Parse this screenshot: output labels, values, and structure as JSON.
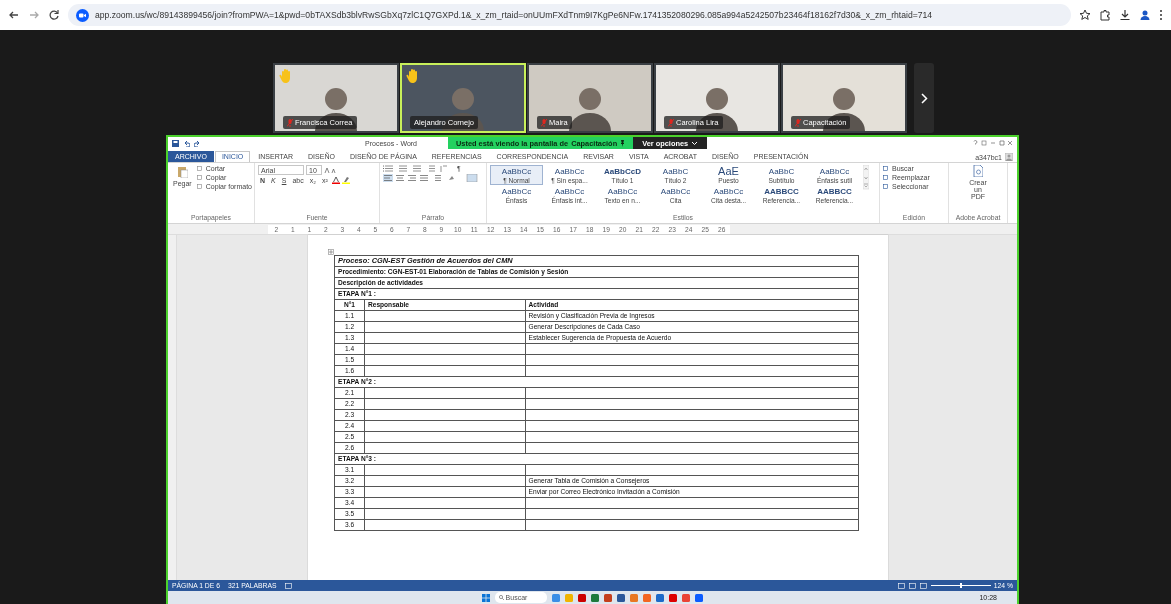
{
  "browser": {
    "url": "app.zoom.us/wc/89143899456/join?fromPWA=1&pwd=0bTAXSdb3blvRwSGbXq7zlC1Q7GXPd.1&_x_zm_rtaid=onUUmFXdTnm9I7KgPe6NFw.1741352080296.085a994a5242507b23464f18162f7d30&_x_zm_rhtaid=714"
  },
  "participants": [
    {
      "name": "Francisca Correa",
      "hand_raised": true,
      "muted": true,
      "speaking": false
    },
    {
      "name": "Alejandro Cornejo",
      "hand_raised": true,
      "muted": false,
      "speaking": true
    },
    {
      "name": "Maira",
      "hand_raised": false,
      "muted": true,
      "speaking": false
    },
    {
      "name": "Carolina Lira",
      "hand_raised": false,
      "muted": true,
      "speaking": false
    },
    {
      "name": "Capacitación",
      "hand_raised": false,
      "muted": true,
      "speaking": false
    }
  ],
  "share_banner": {
    "text": "Usted está viendo la pantalla de",
    "presenter": "Capacitación",
    "options_button": "Ver opciones"
  },
  "word": {
    "title": "Procesos - Word",
    "account": "a347bc1",
    "tabs": [
      {
        "label": "ARCHIVO",
        "selected": false,
        "kind": "file"
      },
      {
        "label": "INICIO",
        "selected": true,
        "kind": "tab"
      },
      {
        "label": "INSERTAR",
        "selected": false,
        "kind": "tab"
      },
      {
        "label": "DISEÑO",
        "selected": false,
        "kind": "tab"
      },
      {
        "label": "DISEÑO DE PÁGINA",
        "selected": false,
        "kind": "tab"
      },
      {
        "label": "REFERENCIAS",
        "selected": false,
        "kind": "tab"
      },
      {
        "label": "CORRESPONDENCIA",
        "selected": false,
        "kind": "tab"
      },
      {
        "label": "REVISAR",
        "selected": false,
        "kind": "tab"
      },
      {
        "label": "VISTA",
        "selected": false,
        "kind": "tab"
      },
      {
        "label": "ACROBAT",
        "selected": false,
        "kind": "tab"
      },
      {
        "label": "DISEÑO",
        "selected": false,
        "kind": "tab"
      },
      {
        "label": "PRESENTACIÓN",
        "selected": false,
        "kind": "tab"
      }
    ],
    "clipboard": {
      "paste": "Pegar",
      "cut": "Cortar",
      "copy": "Copiar",
      "format_painter": "Copiar formato",
      "label": "Portapapeles"
    },
    "font": {
      "name": "Arial",
      "size": "10",
      "label": "Fuente",
      "buttons": [
        "N",
        "K",
        "S",
        "abc",
        "x₂",
        "x²"
      ]
    },
    "paragraph": {
      "label": "Párrafo",
      "symbol": "¶"
    },
    "styles": {
      "label": "Estilos",
      "items": [
        {
          "preview": "AaBbCc",
          "name": "¶ Normal",
          "selected": true
        },
        {
          "preview": "AaBbCc",
          "name": "¶ Sin espa...",
          "selected": false
        },
        {
          "preview": "AaBbCcD",
          "name": "Título 1",
          "selected": false
        },
        {
          "preview": "AaBbC",
          "name": "Título 2",
          "selected": false
        },
        {
          "preview": "AaE",
          "name": "Puesto",
          "selected": false
        },
        {
          "preview": "AaBbC",
          "name": "Subtítulo",
          "selected": false
        },
        {
          "preview": "AaBbCc",
          "name": "Énfasis sutil",
          "selected": false
        },
        {
          "preview": "AaBbCc",
          "name": "Énfasis",
          "selected": false
        },
        {
          "preview": "AaBbCc",
          "name": "Énfasis int...",
          "selected": false
        },
        {
          "preview": "AaBbCc",
          "name": "Texto en n...",
          "selected": false
        },
        {
          "preview": "AaBbCc",
          "name": "Cita",
          "selected": false
        },
        {
          "preview": "AaBbCc",
          "name": "Cita desta...",
          "selected": false
        },
        {
          "preview": "AABBCC",
          "name": "Referencia...",
          "selected": false
        },
        {
          "preview": "AABBCC",
          "name": "Referencia...",
          "selected": false
        }
      ]
    },
    "editing": {
      "label": "Edición",
      "find": "Buscar",
      "replace": "Reemplazar",
      "select": "Seleccionar"
    },
    "acrobat": {
      "label": "Adobe Acrobat",
      "create_pdf": "Crear un PDF"
    },
    "ruler": [
      "2",
      "1",
      "1",
      "2",
      "3",
      "4",
      "5",
      "6",
      "7",
      "8",
      "9",
      "10",
      "11",
      "12",
      "13",
      "14",
      "15",
      "16",
      "17",
      "18",
      "19",
      "20",
      "21",
      "22",
      "23",
      "24",
      "25",
      "26"
    ],
    "document": {
      "title": "Proceso: CGN-EST Gestión de Acuerdos del CMN",
      "procedure": "Procedimiento: CGN-EST-01 Elaboración de Tablas de Comisión y Sesión",
      "description": "Descripción de actividades",
      "columns": [
        "N°1",
        "Responsable",
        "Actividad"
      ],
      "stages": [
        {
          "label": "ETAPA N°1 :",
          "rows": [
            {
              "number": "1.1",
              "activity": "Revisión y Clasificación Previa de Ingresos"
            },
            {
              "number": "1.2",
              "activity": "Generar Descripciones de Cada Caso"
            },
            {
              "number": "1.3",
              "activity": "Establecer Sugerencia de Propuesta de Acuerdo"
            },
            {
              "number": "1.4"
            },
            {
              "number": "1.5"
            },
            {
              "number": "1.6"
            }
          ]
        },
        {
          "label": "ETAPA N°2 :",
          "rows": [
            {
              "number": "2.1"
            },
            {
              "number": "2.2"
            },
            {
              "number": "2.3"
            },
            {
              "number": "2.4"
            },
            {
              "number": "2.5"
            },
            {
              "number": "2.6"
            }
          ]
        },
        {
          "label": "ETAPA N°3 :",
          "rows": [
            {
              "number": "3.1"
            },
            {
              "number": "3.2",
              "activity": "Generar Tabla de Comisión a Consejeros"
            },
            {
              "number": "3.3",
              "activity": "Enviar por Correo Electrónico Invitación a Comisión"
            },
            {
              "number": "3.4"
            },
            {
              "number": "3.5"
            },
            {
              "number": "3.6"
            }
          ]
        }
      ]
    },
    "status": {
      "page": "PÁGINA 1 DE 6",
      "words": "321 PALABRAS",
      "zoom": "124 %",
      "level": 0.5
    }
  },
  "taskbar": {
    "search_placeholder": "Buscar",
    "time": "10:28"
  }
}
